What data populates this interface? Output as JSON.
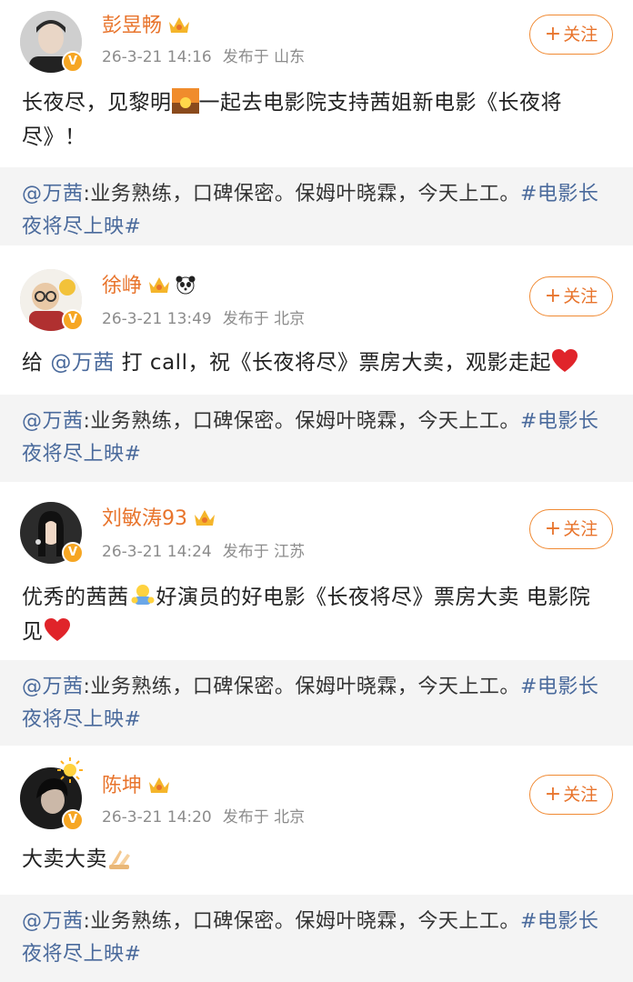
{
  "posts": [
    {
      "username": "彭昱畅",
      "time": "26-3-21 14:16",
      "source": "发布于 山东",
      "follow_label": "关注",
      "text_parts": [
        "长夜尽，见黎明",
        "一起去电影院支持茜姐新电影《长夜将尽》！"
      ],
      "emoji": "sunrise-emoji",
      "quote": {
        "mention": "@万茜",
        "body": ":业务熟练，口碑保密。保姆叶晓霖，今天上工。",
        "topic": "#电影长夜将尽上映#"
      }
    },
    {
      "username": "徐峥",
      "time": "26-3-21 13:49",
      "source": "发布于 北京",
      "follow_label": "关注",
      "text_parts": [
        "给 ",
        "@万茜",
        " 打 call，祝《长夜将尽》票房大卖，观影走起"
      ],
      "emoji": "red-heart-emoji",
      "quote": {
        "mention": "@万茜",
        "body": ":业务熟练，口碑保密。保姆叶晓霖，今天上工。",
        "topic": "#电影长夜将尽上映#"
      }
    },
    {
      "username": "刘敏涛93",
      "time": "26-3-21 14:24",
      "source": "发布于 江苏",
      "follow_label": "关注",
      "text_parts": [
        "优秀的茜茜",
        "好演员的好电影《长夜将尽》票房大卖 电影院见"
      ],
      "emoji": "hug-emoji",
      "quote": {
        "mention": "@万茜",
        "body": ":业务熟练，口碑保密。保姆叶晓霖，今天上工。",
        "topic": "#电影长夜将尽上映#"
      }
    },
    {
      "username": "陈坤",
      "time": "26-3-21 14:20",
      "source": "发布于 北京",
      "follow_label": "关注",
      "text_parts": [
        "大卖大卖"
      ],
      "emoji": "pray-hands-emoji",
      "quote": {
        "mention": "@万茜",
        "body": ":业务熟练，口碑保密。保姆叶晓霖，今天上工。",
        "topic": "#电影长夜将尽上映#"
      }
    }
  ],
  "colors": {
    "username": "#e8742c",
    "link": "#4a6a9c",
    "meta": "#8c8c8c",
    "quote_bg": "#f4f4f4",
    "badge": "#f6a623"
  }
}
